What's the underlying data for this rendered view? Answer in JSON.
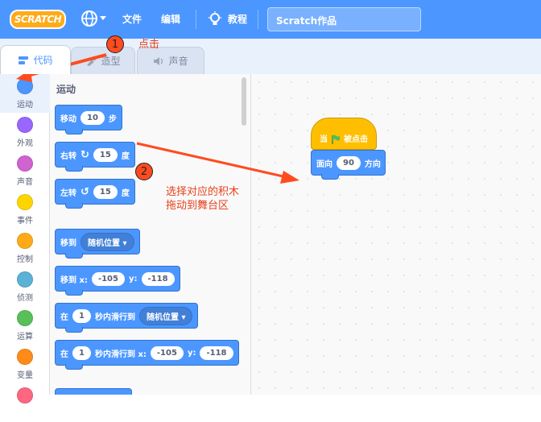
{
  "menubar": {
    "logo": "SCRATCH",
    "file": "文件",
    "edit": "编辑",
    "tutorials": "教程",
    "project_title": "Scratch作品"
  },
  "tabs": [
    {
      "label": "代码",
      "icon": "code-icon",
      "active": true
    },
    {
      "label": "造型",
      "icon": "costume-brush-icon",
      "active": false
    },
    {
      "label": "声音",
      "icon": "speaker-icon",
      "active": false
    }
  ],
  "categories": [
    {
      "label": "运动",
      "color": "#4c97ff"
    },
    {
      "label": "外观",
      "color": "#9966ff"
    },
    {
      "label": "声音",
      "color": "#cf63cf"
    },
    {
      "label": "事件",
      "color": "#ffd500"
    },
    {
      "label": "控制",
      "color": "#ffab19"
    },
    {
      "label": "侦测",
      "color": "#5cb1d6"
    },
    {
      "label": "运算",
      "color": "#59c059"
    },
    {
      "label": "变量",
      "color": "#ff8c1a"
    }
  ],
  "palette": {
    "heading": "运动",
    "move": {
      "label": "移动",
      "value": "10",
      "unit": "步"
    },
    "turn_right": {
      "label": "右转",
      "value": "15",
      "unit": "度"
    },
    "turn_left": {
      "label": "左转",
      "value": "15",
      "unit": "度"
    },
    "goto": {
      "label": "移到",
      "option": "随机位置"
    },
    "goto_xy": {
      "label": "移到 x:",
      "x": "-105",
      "ylabel": "y:",
      "y": "-118"
    },
    "glide": {
      "prefix": "在",
      "secs": "1",
      "mid": "秒内滑行到",
      "option": "随机位置"
    },
    "glide_xy": {
      "prefix": "在",
      "secs": "1",
      "mid": "秒内滑行到 x:",
      "x": "-105",
      "ylabel": "y:",
      "y": "-118"
    }
  },
  "workspace": {
    "hat": {
      "prefix": "当",
      "suffix": "被点击"
    },
    "point": {
      "label": "面向",
      "value": "90",
      "unit": "方向"
    }
  },
  "annotations": {
    "step1_num": "1",
    "step1_text": "点击",
    "step2_num": "2",
    "step2_line1": "选择对应的积木",
    "step2_line2": "拖动到舞台区"
  },
  "colors": {
    "menubar": "#4c97ff",
    "motion": "#4c97ff",
    "event": "#ffbf00",
    "annotation": "#e8411c"
  }
}
